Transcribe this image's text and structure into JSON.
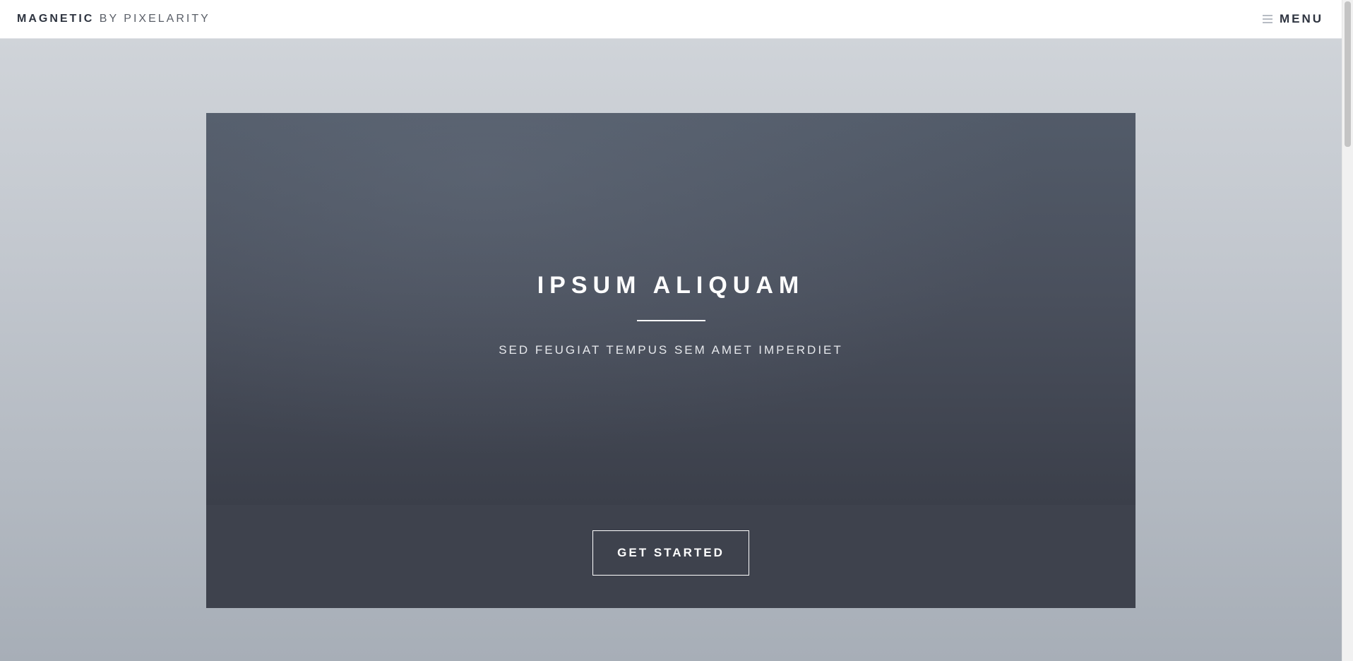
{
  "header": {
    "logo_brand": "MAGNETIC",
    "logo_by": "BY PIXELARITY",
    "menu_label": "MENU",
    "menu_icon": "hamburger-icon"
  },
  "banner": {
    "title": "IPSUM ALIQUAM",
    "subtitle": "SED FEUGIAT TEMPUS SEM AMET IMPERDIET",
    "cta_label": "GET STARTED"
  },
  "colors": {
    "header_bg": "#ffffff",
    "page_bg_top": "#d2d6db",
    "page_bg_bottom": "#a7aeb7",
    "banner_bg": "#4a505d",
    "banner_footer_bg": "#3e424d",
    "text_dark": "#2e3440",
    "text_light": "#ffffff"
  }
}
